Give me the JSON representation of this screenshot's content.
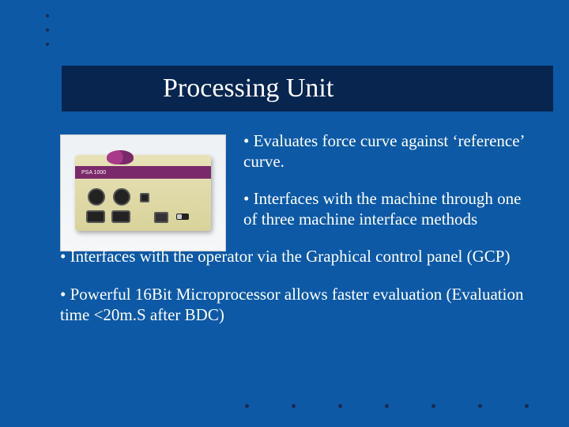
{
  "title": "Processing Unit",
  "device_label": "PSA 1000",
  "bullets": {
    "b1": "• Evaluates force curve against ‘reference’ curve.",
    "b2": "• Interfaces with the machine through one of three machine interface methods",
    "b3": "• Interfaces with the operator via the Graphical control panel (GCP)",
    "b4": "• Powerful 16Bit Microprocessor allows faster evaluation (Evaluation time <20m.S after BDC)"
  }
}
